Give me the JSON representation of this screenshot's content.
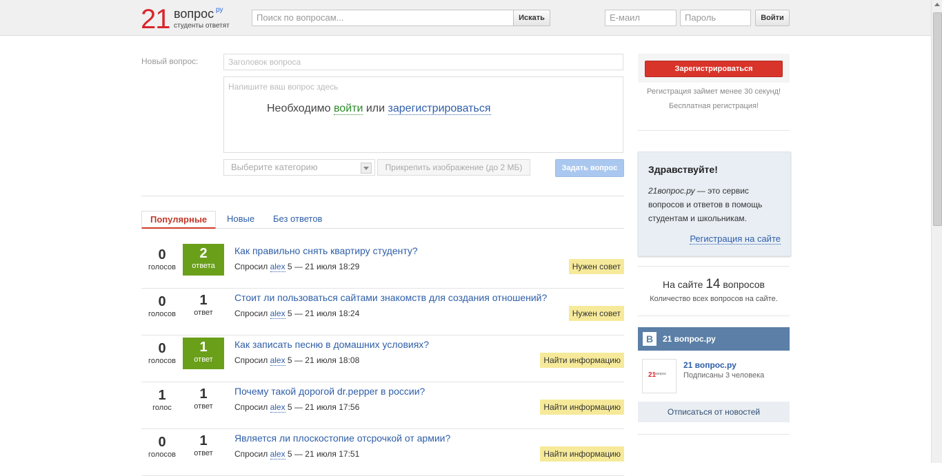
{
  "header": {
    "logo_number": "21",
    "logo_word": "вопрос",
    "logo_suffix": "ру",
    "logo_tagline": "студенты ответят",
    "search_placeholder": "Поиск по вопросам...",
    "search_button": "Искать",
    "email_placeholder": "E-маил",
    "password_placeholder": "Пароль",
    "login_button": "Войти"
  },
  "form": {
    "label": "Новый вопрос:",
    "title_placeholder": "Заголовок вопроса",
    "body_placeholder": "Напишите ваш вопрос здесь",
    "need_text": "Необходимо",
    "login_link": "войти",
    "or_text": "или",
    "register_link": "зарегистрироваться",
    "category_placeholder": "Выберите категорию",
    "attach_button": "Прикрепить изображение (до 2 МБ)",
    "ask_button": "Задать вопрос"
  },
  "tabs": [
    {
      "label": "Популярные",
      "active": true
    },
    {
      "label": "Новые",
      "active": false
    },
    {
      "label": "Без ответов",
      "active": false
    }
  ],
  "questions": [
    {
      "votes": "0",
      "votes_label": "голосов",
      "answers": "2",
      "answers_label": "ответа",
      "title": "Как правильно снять квартиру студенту?",
      "asked": "Спросил",
      "user": "alex",
      "rep": "5",
      "date": "— 21 июля 18:29",
      "tag": "Нужен совет",
      "highlight": true
    },
    {
      "votes": "0",
      "votes_label": "голосов",
      "answers": "1",
      "answers_label": "ответ",
      "title": "Стоит ли пользоваться сайтами знакомств для создания отношений?",
      "asked": "Спросил",
      "user": "alex",
      "rep": "5",
      "date": "— 21 июля 18:24",
      "tag": "Нужен совет",
      "highlight": false
    },
    {
      "votes": "0",
      "votes_label": "голосов",
      "answers": "1",
      "answers_label": "ответ",
      "title": "Как записать песню в домашних условиях?",
      "asked": "Спросил",
      "user": "alex",
      "rep": "5",
      "date": "— 21 июля 18:08",
      "tag": "Найти информацию",
      "highlight": true
    },
    {
      "votes": "1",
      "votes_label": "голос",
      "answers": "1",
      "answers_label": "ответ",
      "title": "Почему такой дорогой dr.pepper в россии?",
      "asked": "Спросил",
      "user": "alex",
      "rep": "5",
      "date": "— 21 июля 17:56",
      "tag": "Найти информацию",
      "highlight": false
    },
    {
      "votes": "0",
      "votes_label": "голосов",
      "answers": "1",
      "answers_label": "ответ",
      "title": "Является ли плоскостопие отсрочкой от армии?",
      "asked": "Спросил",
      "user": "alex",
      "rep": "5",
      "date": "— 21 июля 17:51",
      "tag": "Найти информацию",
      "highlight": false
    }
  ],
  "sidebar": {
    "register_button": "Зарегистрироваться",
    "register_note": "Регистрация займет менее 30 секунд!",
    "free_note": "Бесплатная регистрация!",
    "hello_title": "Здравствуйте!",
    "hello_site": "21вопрос.ру",
    "hello_text": " — это сервис вопросов и ответов в помощь студентам и школьникам.",
    "hello_link": "Регистрация на сайте",
    "stat_prefix": "На сайте",
    "stat_count": "14",
    "stat_suffix": "вопросов",
    "stat_note": "Количество всех вопросов на сайте.",
    "vk_logo": "B",
    "vk_title": "21 вопрос.ру",
    "vk_thumb_num": "21",
    "vk_thumb_word": "вопрос",
    "vk_name": "21 вопрос.ру",
    "vk_subscribers": "Подписаны 3 человека",
    "vk_unsubscribe": "Отписаться от новостей"
  },
  "colors": {
    "brand_red": "#d8262d",
    "link_blue": "#2e5ea8",
    "answered_green": "#6a9f1a",
    "tag_yellow": "#f6ea9a",
    "vk_blue": "#5b7fa6"
  }
}
